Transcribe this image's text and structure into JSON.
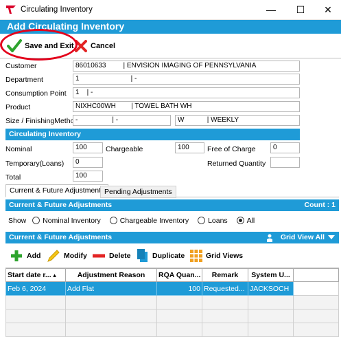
{
  "window": {
    "title": "Circulating Inventory",
    "minimize": "—",
    "maximize": "☐",
    "close": "✕"
  },
  "header": {
    "title": "Add Circulating Inventory"
  },
  "toolbar": {
    "save_exit_label": "Save and Exit",
    "cancel_label": "Cancel"
  },
  "form": {
    "customer_label": "Customer",
    "customer_value": "86010633         | ENVISION IMAGING OF PENNSYLVANIA",
    "department_label": "Department",
    "department_value": "1                           | -",
    "consumption_label": "Consumption Point",
    "consumption_value": "1    | -",
    "product_label": "Product",
    "product_value": "NIXHC00WH        | TOWEL BATH WH",
    "size_label": "Size / FinishingMethod",
    "size_value": "-                  | -",
    "finishing_value": "W            | WEEKLY"
  },
  "circ": {
    "section_title": "Circulating Inventory",
    "nominal_label": "Nominal",
    "nominal_value": "100",
    "chargeable_label": "Chargeable",
    "chargeable_value": "100",
    "free_label": "Free of Charge",
    "free_value": "0",
    "temporary_label": "Temporary(Loans)",
    "temporary_value": "0",
    "returned_label": "Returned Quantity",
    "returned_value": "",
    "total_label": "Total",
    "total_value": "100"
  },
  "tabs": {
    "current": "Current & Future Adjustments",
    "pending": "Pending Adjustments"
  },
  "adjust": {
    "section_title": "Current & Future Adjustments",
    "count": "Count : 1",
    "show_label": "Show",
    "opt_nominal": "Nominal Inventory",
    "opt_chargeable": "Chargeable Inventory",
    "opt_loans": "Loans",
    "opt_all": "All",
    "section2_title": "Current & Future Adjustments",
    "grid_view": "Grid View All"
  },
  "grid_toolbar": {
    "add": "Add",
    "modify": "Modify",
    "delete": "Delete",
    "duplicate": "Duplicate",
    "grid_views": "Grid Views"
  },
  "grid": {
    "columns": [
      "Start date r...",
      "Adjustment Reason",
      "RQA Quan...",
      "Remark",
      "System U..."
    ],
    "rows": [
      {
        "start": "Feb 6, 2024",
        "reason": "Add Flat",
        "qty": "100",
        "remark": "Requested...",
        "user": "JACKSOCH"
      }
    ]
  },
  "colors": {
    "accent": "#1f9bd7",
    "highlight": "#e3001b"
  }
}
